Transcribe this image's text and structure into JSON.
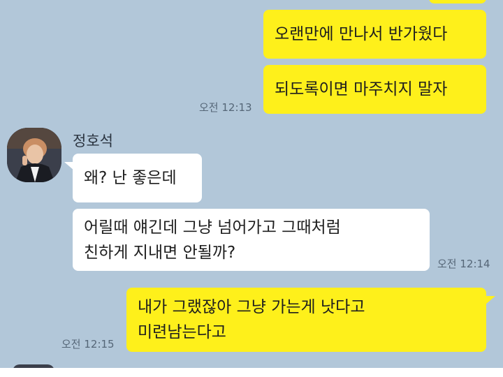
{
  "colors": {
    "background": "#b2c7d9",
    "my_bubble": "#fef01b",
    "their_bubble": "#ffffff",
    "timestamp": "#556677"
  },
  "messages": {
    "m1": {
      "text": "오랜만에 만나서 반가웠다"
    },
    "m2": {
      "text": "되도록이면 마주치지 말자",
      "time": "오전 12:13"
    },
    "sender": {
      "name": "정호석"
    },
    "m3": {
      "text": "왜? 난 좋은데"
    },
    "m4": {
      "line1": "어릴때 얘긴데 그냥 넘어가고 그때처럼",
      "line2": "친하게 지내면 안될까?",
      "time": "오전 12:14"
    },
    "m5": {
      "line1": "내가 그랬잖아 그냥 가는게 낫다고",
      "line2": "미련남는다고",
      "time": "오전 12:15"
    }
  }
}
